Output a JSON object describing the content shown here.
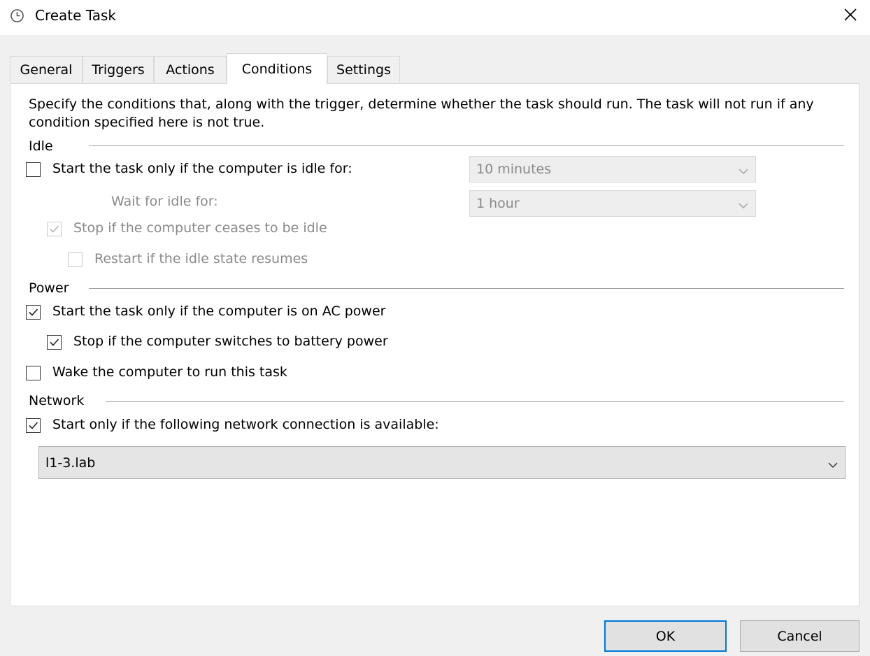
{
  "window": {
    "title": "Create Task",
    "icon": "clock-icon",
    "close_icon": "close-icon"
  },
  "tabs": [
    {
      "label": "General",
      "active": false
    },
    {
      "label": "Triggers",
      "active": false
    },
    {
      "label": "Actions",
      "active": false
    },
    {
      "label": "Conditions",
      "active": true
    },
    {
      "label": "Settings",
      "active": false
    }
  ],
  "conditions": {
    "description": "Specify the conditions that, along with the trigger, determine whether the task should run.  The task will not run  if any condition specified here is not true.",
    "idle": {
      "group_title": "Idle",
      "start_if_idle": {
        "label": "Start the task only if the computer is idle for:",
        "checked": false
      },
      "idle_duration": {
        "value": "10 minutes",
        "enabled": false
      },
      "wait_label": "Wait for idle for:",
      "wait_duration": {
        "value": "1 hour",
        "enabled": false
      },
      "stop_if_not_idle": {
        "label": "Stop if the computer ceases to be idle",
        "checked": true,
        "enabled": false
      },
      "restart_if_idle": {
        "label": "Restart if the idle state resumes",
        "checked": false,
        "enabled": false
      }
    },
    "power": {
      "group_title": "Power",
      "ac_power": {
        "label": "Start the task only if the computer is on AC power",
        "checked": true
      },
      "stop_on_battery": {
        "label": "Stop if the computer switches to battery power",
        "checked": true
      },
      "wake_to_run": {
        "label": "Wake the computer to run this task",
        "checked": false
      }
    },
    "network": {
      "group_title": "Network",
      "start_if_network": {
        "label": "Start only if the following network connection is available:",
        "checked": true
      },
      "connection": {
        "value": "l1-3.lab",
        "enabled": true
      }
    }
  },
  "buttons": {
    "ok": "OK",
    "cancel": "Cancel"
  },
  "colors": {
    "accent": "#0078d7",
    "dialog_bg": "#f0f0f0",
    "panel_bg": "#ffffff",
    "disabled_text": "#8a8a8a"
  }
}
